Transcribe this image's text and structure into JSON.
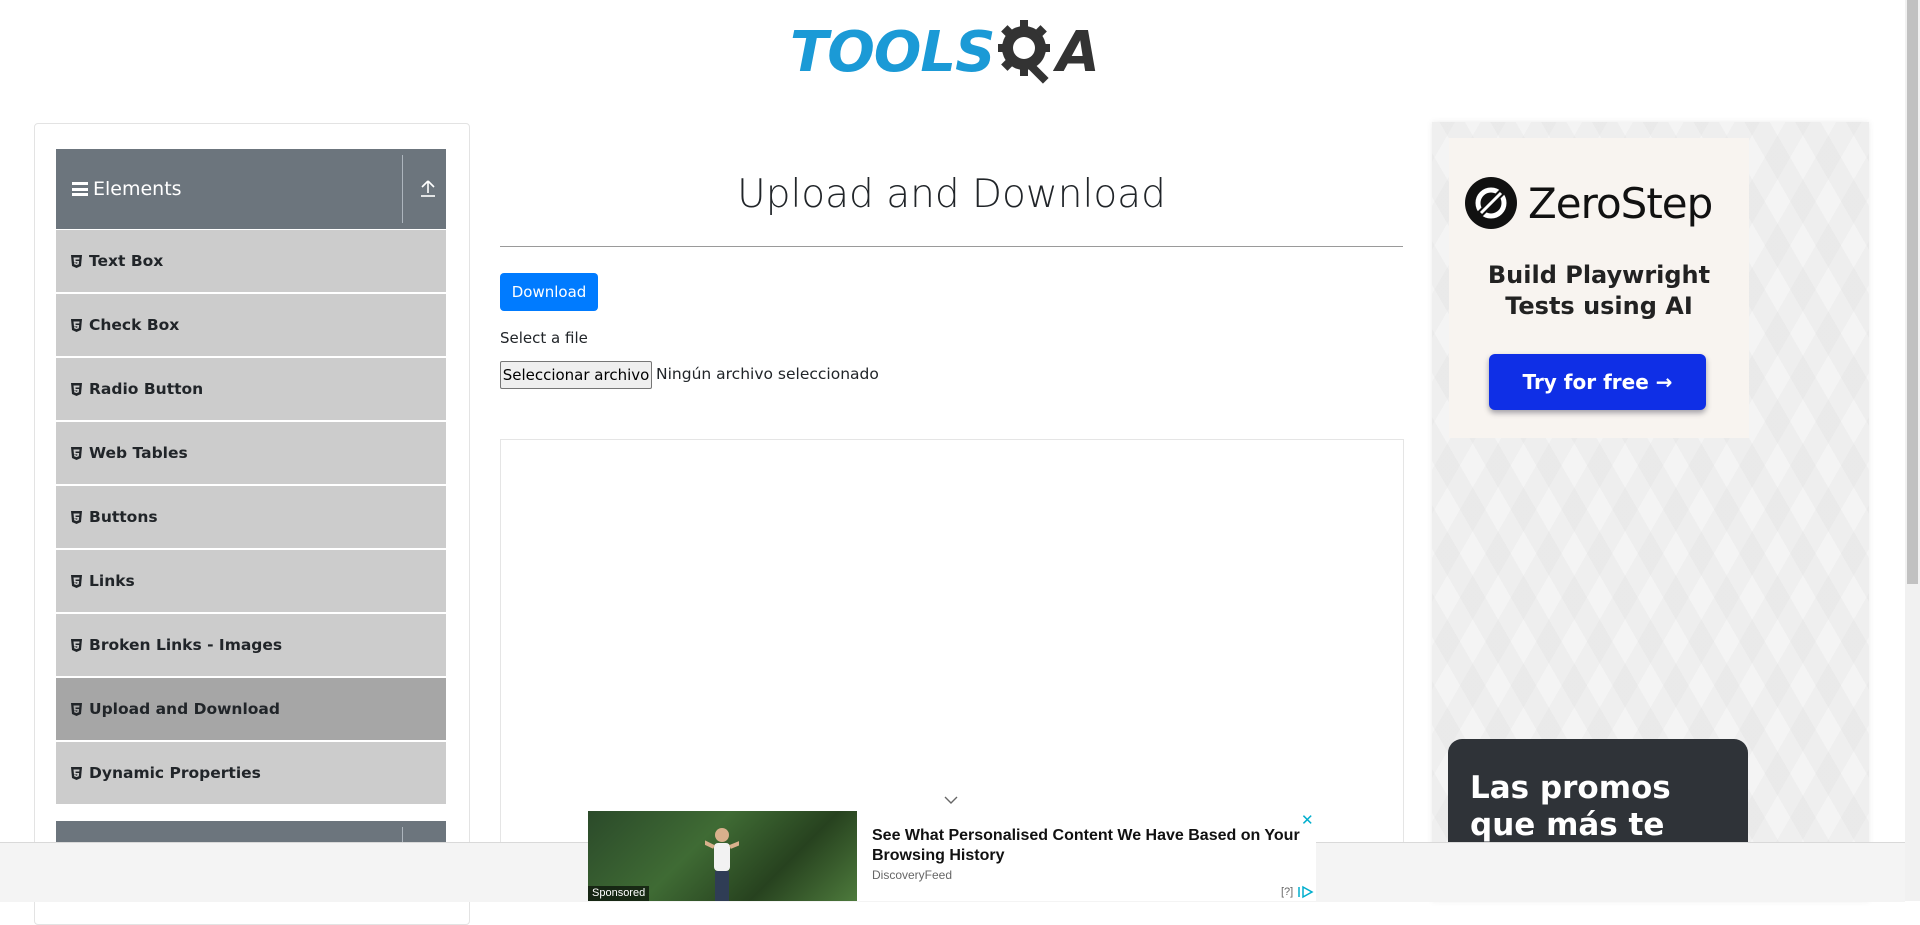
{
  "header": {
    "logo_tools": "TOOLS",
    "logo_a": "A"
  },
  "sidebar": {
    "group_title": "Elements",
    "items": [
      {
        "label": "Text Box",
        "active": false
      },
      {
        "label": "Check Box",
        "active": false
      },
      {
        "label": "Radio Button",
        "active": false
      },
      {
        "label": "Web Tables",
        "active": false
      },
      {
        "label": "Buttons",
        "active": false
      },
      {
        "label": "Links",
        "active": false
      },
      {
        "label": "Broken Links - Images",
        "active": false
      },
      {
        "label": "Upload and Download",
        "active": true
      },
      {
        "label": "Dynamic Properties",
        "active": false
      }
    ]
  },
  "main": {
    "title": "Upload and Download",
    "download_label": "Download",
    "select_label": "Select a file",
    "file_button_label": "Seleccionar archivo",
    "file_status": "Ningún archivo seleccionado"
  },
  "ads": {
    "zerostep_name": "ZeroStep",
    "zerostep_tagline": "Build Playwright Tests using AI",
    "zerostep_cta": "Try for free →",
    "promo_text": "Las promos que más te gustan",
    "bottom_headline": "See What Personalised Content We Have Based on Your Browsing History",
    "bottom_source": "DiscoveryFeed",
    "sponsored_label": "Sponsored",
    "help_label": "[?]",
    "close_glyph": "✕"
  },
  "colors": {
    "brand_blue": "#1b9ad6",
    "primary_button": "#007bff",
    "sidebar_header": "#6c757d",
    "menu_item": "#cccccc",
    "menu_item_active": "#a6a6a6",
    "zerostep_cta": "#0f2fe6"
  },
  "icons": {
    "hamburger": "bars-icon",
    "collapse": "upload-arrow-icon",
    "menu_item": "html5-icon",
    "chevron": "chevron-down-icon"
  }
}
